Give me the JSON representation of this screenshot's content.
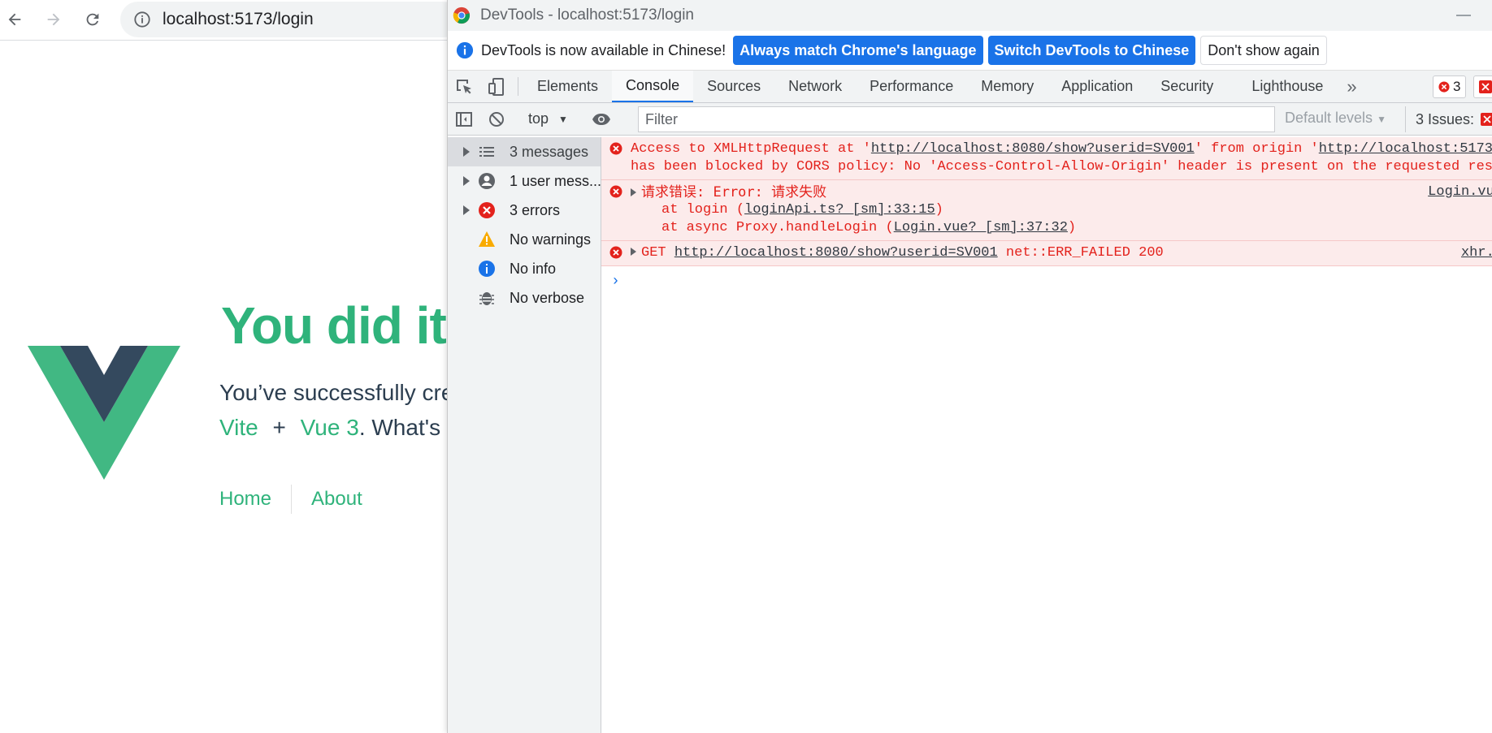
{
  "browser": {
    "url": "localhost:5173/login"
  },
  "page": {
    "greeting": "You did it!",
    "subtitle_line1": "You’ve successfully cre",
    "subtitle_vite": "Vite",
    "subtitle_plus": "+",
    "subtitle_vue": "Vue 3",
    "subtitle_rest": ". What's",
    "nav_home": "Home",
    "nav_about": "About",
    "brand_colors": {
      "green": "#41b883",
      "dark": "#34495e"
    }
  },
  "devtools": {
    "title": "DevTools - localhost:5173/login",
    "infobar": {
      "text": "DevTools is now available in Chinese!",
      "match_button": "Always match Chrome's language",
      "switch_button": "Switch DevTools to Chinese",
      "dismiss_button": "Don't show again"
    },
    "tabs": [
      "Elements",
      "Console",
      "Sources",
      "Network",
      "Performance",
      "Memory",
      "Application",
      "Security",
      "Lighthouse"
    ],
    "more_tabs": "»",
    "error_count": "3",
    "console_toolbar": {
      "context": "top",
      "filter_placeholder": "Filter",
      "levels": "Default levels",
      "issues": "3 Issues:"
    },
    "sidebar": [
      {
        "label": "3 messages",
        "icon": "list-icon"
      },
      {
        "label": "1 user mess...",
        "icon": "user-icon"
      },
      {
        "label": "3 errors",
        "icon": "error-icon"
      },
      {
        "label": "No warnings",
        "icon": "warning-icon"
      },
      {
        "label": "No info",
        "icon": "info-icon"
      },
      {
        "label": "No verbose",
        "icon": "bug-icon"
      }
    ],
    "messages": {
      "cors": {
        "line1_pre": "Access to XMLHttpRequest at '",
        "line1_url": "http://localhost:8080/show?userid=SV001",
        "line1_mid": "' from origin '",
        "line1_origin": "http://localhost:5173",
        "line1_end": "'",
        "line2": "has been blocked by CORS policy: No 'Access-Control-Allow-Origin' header is present on the requested resour"
      },
      "request_error": {
        "text": "请求错误:  Error: 请求失败",
        "source": "Login.vue",
        "stack1_pre": "at login (",
        "stack1_link": "loginApi.ts? [sm]:33:15",
        "stack1_end": ")",
        "stack2_pre": "at async Proxy.handleLogin (",
        "stack2_link": "Login.vue? [sm]:37:32",
        "stack2_end": ")"
      },
      "get_error": {
        "pre": "GET ",
        "url": "http://localhost:8080/show?userid=SV001",
        "post": " net::ERR_FAILED 200",
        "source": "xhr.j"
      },
      "prompt": "›"
    }
  }
}
